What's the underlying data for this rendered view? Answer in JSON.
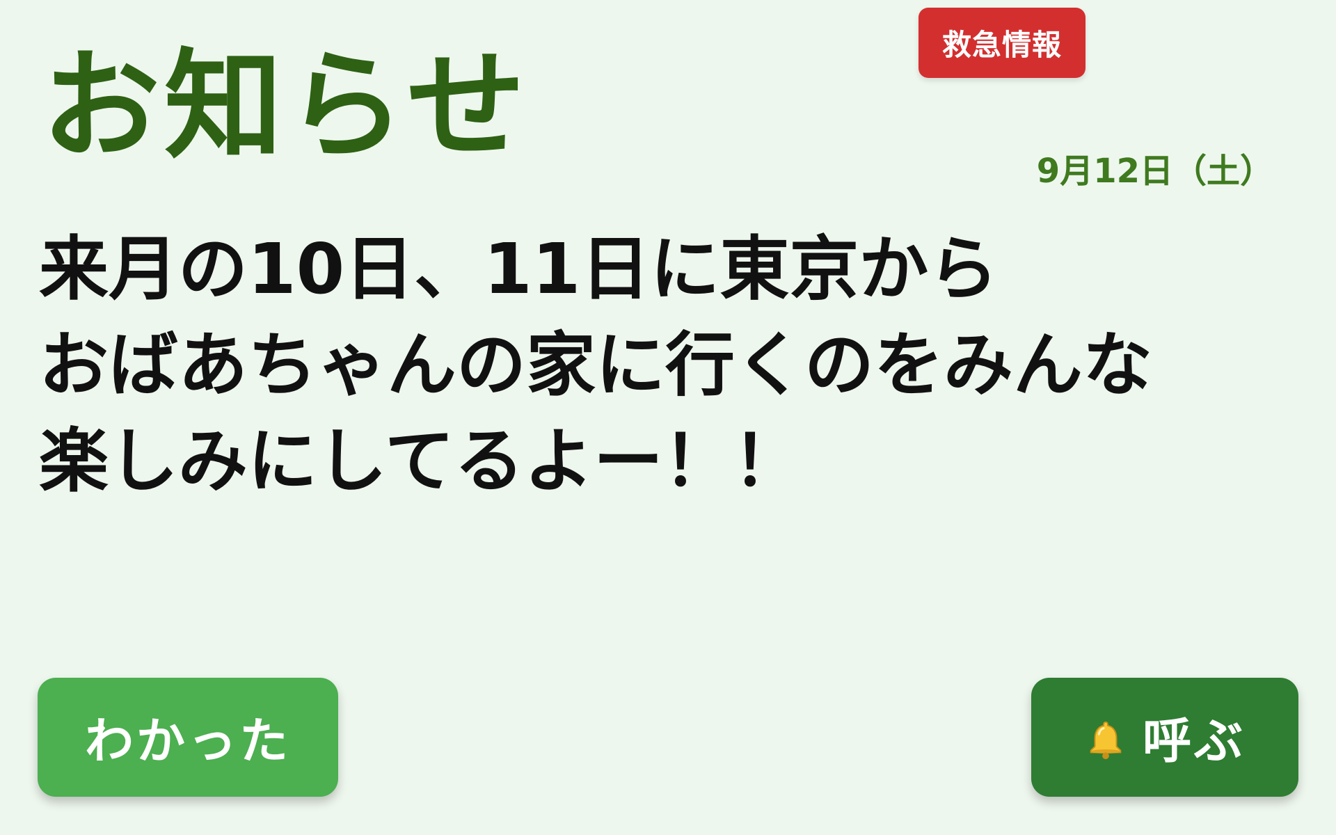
{
  "header": {
    "emergency_label": "救急情報",
    "title": "お知らせ",
    "date": "9月12日（土）"
  },
  "message": {
    "text": "来月の10日、11日に東京から\nおばあちゃんの家に行くのをみんな\n楽しみにしてるよー！！"
  },
  "actions": {
    "ack_label": "わかった",
    "call_label": "呼ぶ",
    "call_icon": "bell-icon"
  },
  "colors": {
    "background": "#eef7ee",
    "title": "#2e6114",
    "emergency": "#d32f2f",
    "ack": "#4caf50",
    "call": "#2e7d32"
  }
}
